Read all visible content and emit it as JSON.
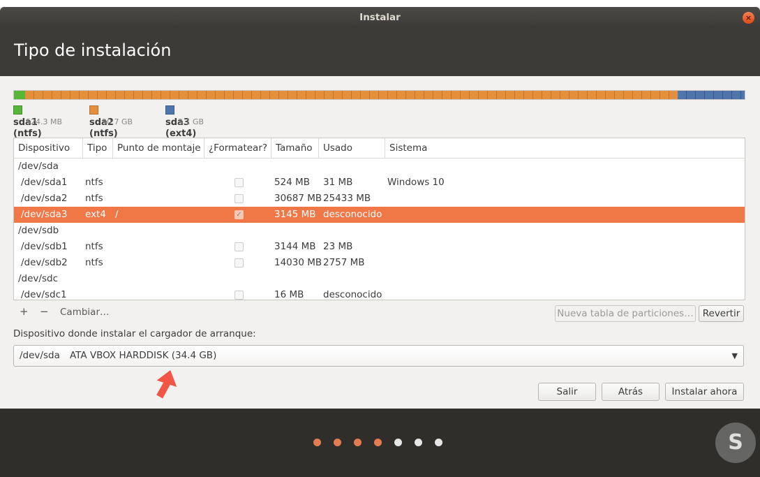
{
  "window": {
    "title": "Instalar",
    "close_glyph": "×"
  },
  "header": {
    "title": "Tipo de instalación"
  },
  "partition_bar": {
    "segments": [
      {
        "name": "sda1 (ntfs)",
        "size": "524.3 MB",
        "color": "#57b53a",
        "fraction": 0.0152
      },
      {
        "name": "sda2 (ntfs)",
        "size": "30.7 GB",
        "color": "#e38f3c",
        "fraction": 0.8934
      },
      {
        "name": "sda3 (ext4)",
        "size": "3.1 GB",
        "color": "#4f75ad",
        "fraction": 0.0914
      }
    ]
  },
  "table": {
    "columns": [
      "Dispositivo",
      "Tipo",
      "Punto de montaje",
      "¿Formatear?",
      "Tamaño",
      "Usado",
      "Sistema"
    ],
    "rows": [
      {
        "device": "/dev/sda",
        "type": "",
        "mount": "",
        "format": "",
        "size": "",
        "used": "",
        "system": ""
      },
      {
        "device": "/dev/sda1",
        "type": "ntfs",
        "mount": "",
        "format": "",
        "size": "524 MB",
        "used": "31 MB",
        "system": "Windows 10"
      },
      {
        "device": "/dev/sda2",
        "type": "ntfs",
        "mount": "",
        "format": "",
        "size": "30687 MB",
        "used": "25433 MB",
        "system": ""
      },
      {
        "device": "/dev/sda3",
        "type": "ext4",
        "mount": "/",
        "format": "✓",
        "size": "3145 MB",
        "used": "desconocido",
        "system": ""
      },
      {
        "device": "/dev/sdb",
        "type": "",
        "mount": "",
        "format": "",
        "size": "",
        "used": "",
        "system": ""
      },
      {
        "device": "/dev/sdb1",
        "type": "ntfs",
        "mount": "",
        "format": "",
        "size": "3144 MB",
        "used": "23 MB",
        "system": ""
      },
      {
        "device": "/dev/sdb2",
        "type": "ntfs",
        "mount": "",
        "format": "",
        "size": "14030 MB",
        "used": "2757 MB",
        "system": ""
      },
      {
        "device": "/dev/sdc",
        "type": "",
        "mount": "",
        "format": "",
        "size": "",
        "used": "",
        "system": ""
      },
      {
        "device": "/dev/sdc1",
        "type": "",
        "mount": "",
        "format": "",
        "size": "16 MB",
        "used": "desconocido",
        "system": ""
      }
    ]
  },
  "toolbar": {
    "add": "+",
    "remove": "−",
    "change": "Cambiar…",
    "new_table": "Nueva tabla de particiones…",
    "revert": "Revertir"
  },
  "bootloader": {
    "label": "Dispositivo donde instalar el cargador de arranque:",
    "device": "/dev/sda",
    "description": "ATA VBOX HARDDISK (34.4 GB)",
    "caret": "▼"
  },
  "buttons": {
    "quit": "Salir",
    "back": "Atrás",
    "install": "Instalar ahora"
  },
  "progress": {
    "total_steps": 7,
    "completed_steps": 4
  },
  "watermark": {
    "text": "S"
  }
}
